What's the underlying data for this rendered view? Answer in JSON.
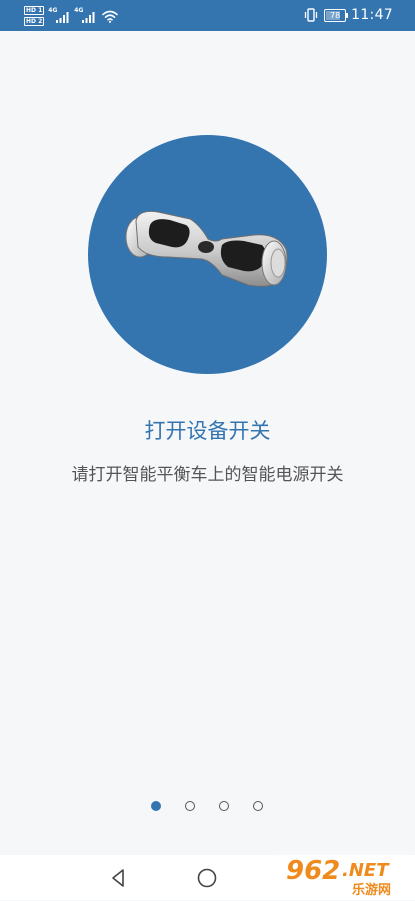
{
  "status_bar": {
    "sim_badges": [
      "HD 1",
      "HD 2"
    ],
    "network_types": [
      "4G",
      "4G"
    ],
    "battery_level": "78",
    "time": "11:47",
    "icons": [
      "signal-icon",
      "wifi-icon",
      "vibrate-icon",
      "battery-icon"
    ]
  },
  "main": {
    "illustration": "hoverboard-image",
    "title": "打开设备开关",
    "description": "请打开智能平衡车上的智能电源开关"
  },
  "pager": {
    "total": 4,
    "active_index": 0
  },
  "nav_bar": {
    "buttons": [
      "back-icon",
      "home-icon"
    ]
  },
  "watermark": {
    "text": "962.NET",
    "subtext": "乐游网"
  },
  "colors": {
    "accent": "#3475b0",
    "background": "#f6f7f9",
    "text_secondary": "#555555"
  }
}
